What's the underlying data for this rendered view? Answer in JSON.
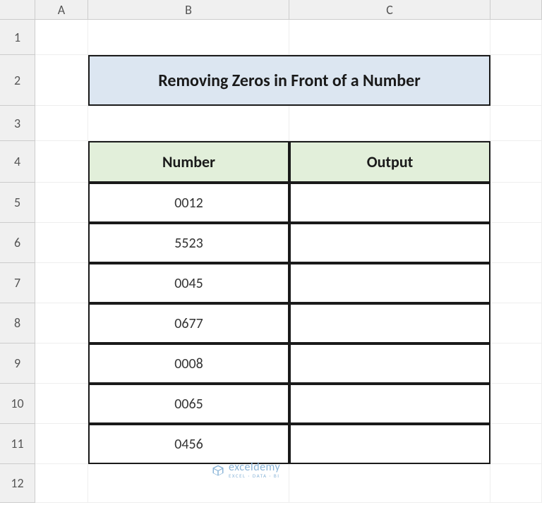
{
  "columns": [
    "A",
    "B",
    "C"
  ],
  "rows": [
    "1",
    "2",
    "3",
    "4",
    "5",
    "6",
    "7",
    "8",
    "9",
    "10",
    "11",
    "12"
  ],
  "title": "Removing Zeros in Front of a Number",
  "headers": {
    "number": "Number",
    "output": "Output"
  },
  "data": [
    {
      "number": "0012",
      "output": ""
    },
    {
      "number": "5523",
      "output": ""
    },
    {
      "number": "0045",
      "output": ""
    },
    {
      "number": "0677",
      "output": ""
    },
    {
      "number": "0008",
      "output": ""
    },
    {
      "number": "0065",
      "output": ""
    },
    {
      "number": "0456",
      "output": ""
    }
  ],
  "watermark": {
    "main": "exceldemy",
    "sub": "EXCEL · DATA · BI"
  }
}
